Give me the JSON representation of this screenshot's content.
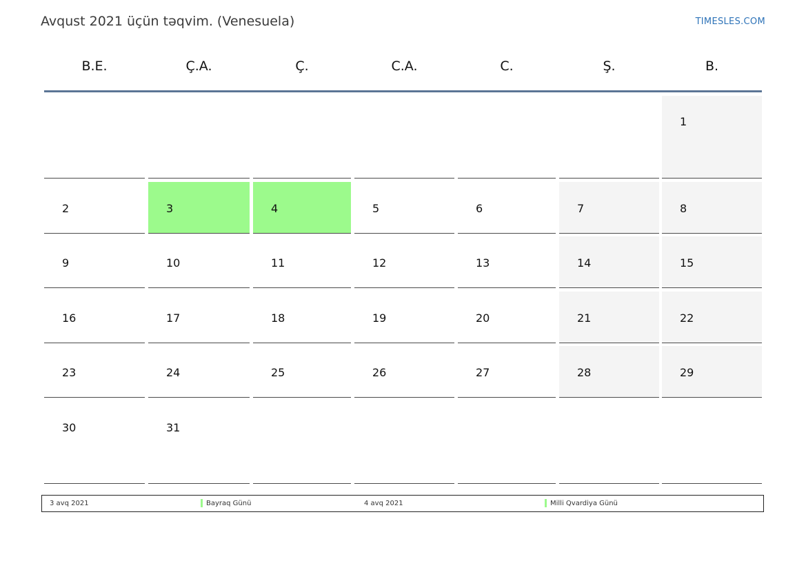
{
  "header": {
    "title": "Avqust 2021 üçün təqvim. (Venesuela)",
    "brand": "TIMESLES.COM"
  },
  "weekdays": [
    "B.E.",
    "Ç.A.",
    "Ç.",
    "C.A.",
    "C.",
    "Ş.",
    "B."
  ],
  "weeks": [
    [
      "",
      "",
      "",
      "",
      "",
      "",
      "1"
    ],
    [
      "2",
      "3",
      "4",
      "5",
      "6",
      "7",
      "8"
    ],
    [
      "9",
      "10",
      "11",
      "12",
      "13",
      "14",
      "15"
    ],
    [
      "16",
      "17",
      "18",
      "19",
      "20",
      "21",
      "22"
    ],
    [
      "23",
      "24",
      "25",
      "26",
      "27",
      "28",
      "29"
    ],
    [
      "30",
      "31",
      "",
      "",
      "",
      "",
      ""
    ]
  ],
  "holidays": [
    {
      "date": "3 avq 2021",
      "name": "Bayraq Günü",
      "day": "3"
    },
    {
      "date": "4 avq 2021",
      "name": "Milli Qvardiya Günü",
      "day": "4"
    }
  ],
  "colors": {
    "holiday": "#9cfa8c",
    "weekend": "#f4f4f4",
    "header_rule": "#5b7595",
    "brand": "#2e73b8"
  }
}
